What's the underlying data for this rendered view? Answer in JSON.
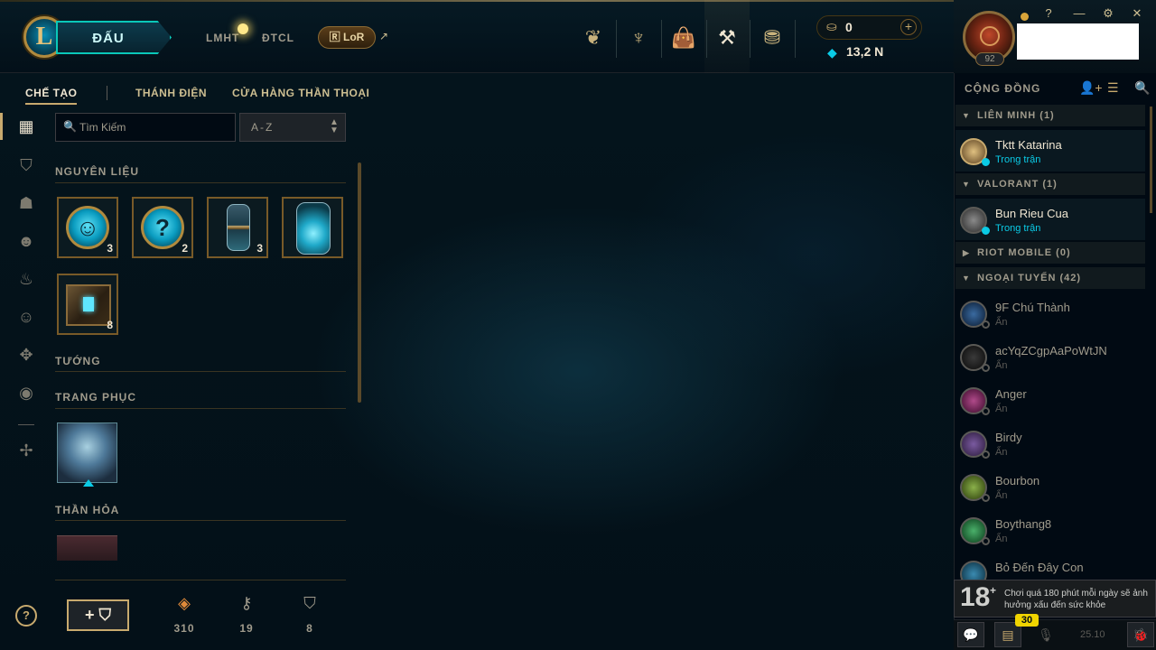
{
  "header": {
    "play_label": "ĐẤU",
    "games": [
      "LMHT",
      "ĐTCL"
    ],
    "lor_label": "LoR",
    "rp": "0",
    "be": "13,2 N",
    "rp_add": "+",
    "level": "92",
    "window": {
      "help": "?",
      "minimize": "—",
      "settings": "⚙",
      "close": "✕"
    }
  },
  "subnav": {
    "tabs": [
      "CHẾ TẠO",
      "THÁNH ĐIỆN",
      "CỬA HÀNG THẦN THOẠI"
    ]
  },
  "search": {
    "placeholder": "Tìm Kiếm",
    "sort": "A-Z"
  },
  "loot": {
    "sections": [
      "NGUYÊN LIỆU",
      "TƯỚNG",
      "TRANG PHỤC",
      "THẦN HỎA"
    ],
    "materials": [
      {
        "icon": "emote-orb-icon",
        "count": "3"
      },
      {
        "icon": "mystery-orb-icon",
        "count": "2"
      },
      {
        "icon": "capsule-icon",
        "count": "3"
      },
      {
        "icon": "glowing-capsule-icon",
        "count": ""
      },
      {
        "icon": "hextech-chest-icon",
        "count": "8"
      }
    ]
  },
  "resources": {
    "orange_essence": "310",
    "keys": "19",
    "chests": "8",
    "craft_label": "+"
  },
  "social": {
    "title": "CỘNG ĐỒNG",
    "groups": [
      {
        "name": "LIÊN MINH (1)"
      },
      {
        "name": "VALORANT (1)"
      },
      {
        "name": "RIOT MOBILE (0)"
      },
      {
        "name": "NGOẠI TUYẾN (42)"
      }
    ],
    "online": [
      {
        "name": "Tktt Katarina",
        "status": "Trong trận"
      },
      {
        "name": "Bun Rieu Cua",
        "status": "Trong trận"
      }
    ],
    "offline": [
      {
        "name": "9F Chú Thành",
        "status": "Ẩn"
      },
      {
        "name": "acYqZCgpAaPoWtJN",
        "status": "Ẩn"
      },
      {
        "name": "Anger",
        "status": "Ẩn"
      },
      {
        "name": "Birdy",
        "status": "Ẩn"
      },
      {
        "name": "Bourbon",
        "status": "Ẩn"
      },
      {
        "name": "Boythang8",
        "status": "Ẩn"
      },
      {
        "name": "Bỏ Đến Đây Con",
        "status": ""
      }
    ],
    "warning": {
      "age": "18",
      "text": "Chơi quá 180 phút mỗi ngày sẽ ảnh hưởng xấu đến sức khỏe"
    },
    "notif_count": "30",
    "version": "25.10"
  },
  "colors": {
    "gold": "#c8aa6e",
    "cyan": "#0acbe6",
    "bg": "#010a13"
  }
}
